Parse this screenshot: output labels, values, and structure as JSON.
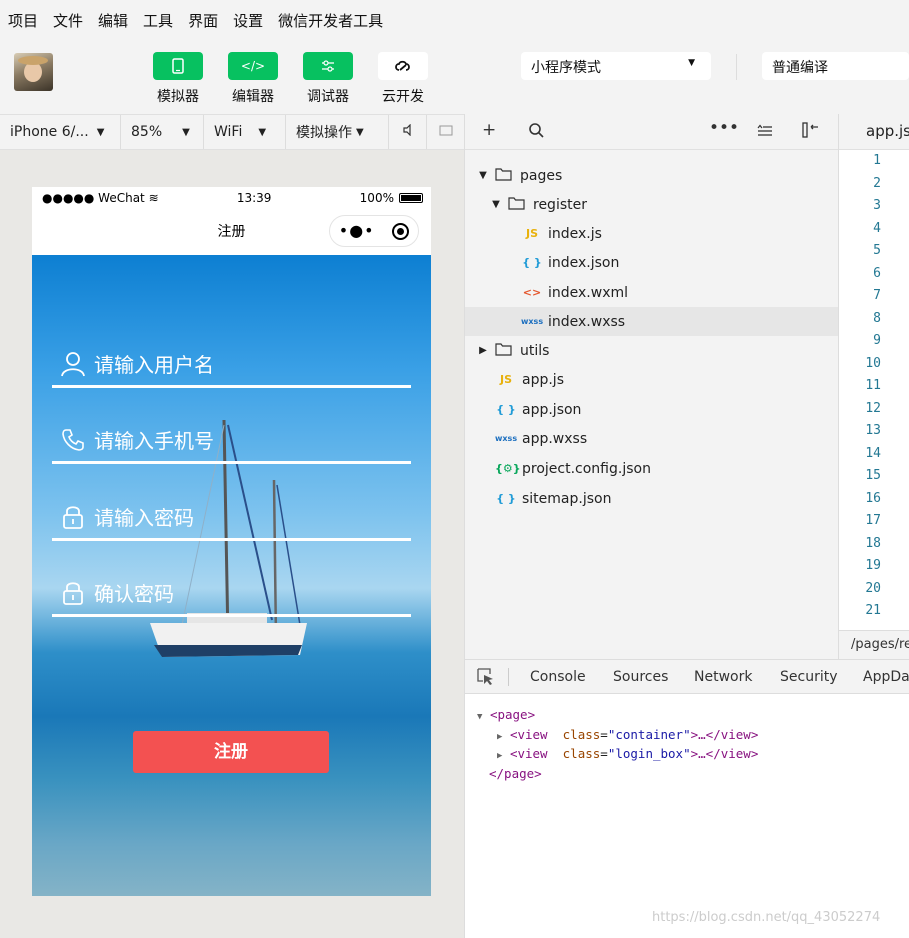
{
  "menu": [
    "项目",
    "文件",
    "编辑",
    "工具",
    "界面",
    "设置",
    "微信开发者工具"
  ],
  "toolbar": {
    "simulator": "模拟器",
    "editor": "编辑器",
    "debugger": "调试器",
    "cloud": "云开发",
    "mode_select": "小程序模式",
    "compile_select": "普通编译"
  },
  "device_bar": {
    "device": "iPhone 6/...",
    "zoom": "85%",
    "network": "WiFi",
    "simulate": "模拟操作"
  },
  "phone": {
    "carrier": "●●●●● WeChat",
    "time": "13:39",
    "battery": "100%",
    "nav_title": "注册",
    "fields": {
      "username": "请输入用户名",
      "phone": "请输入手机号",
      "password": "请输入密码",
      "confirm": "确认密码"
    },
    "register_button": "注册"
  },
  "file_tree": {
    "pages": "pages",
    "register": "register",
    "index_js": "index.js",
    "index_json": "index.json",
    "index_wxml": "index.wxml",
    "index_wxss": "index.wxss",
    "utils": "utils",
    "app_js": "app.js",
    "app_json": "app.json",
    "app_wxss": "app.wxss",
    "project_config": "project.config.json",
    "sitemap": "sitemap.json"
  },
  "editor": {
    "tab": "app.js",
    "line_numbers": [
      "1",
      "2",
      "3",
      "4",
      "5",
      "6",
      "7",
      "8",
      "9",
      "10",
      "11",
      "12",
      "13",
      "14",
      "15",
      "16",
      "17",
      "18",
      "19",
      "20",
      "21"
    ],
    "path": "/pages/re"
  },
  "devtools": {
    "tabs": [
      "Console",
      "Sources",
      "Network",
      "Security",
      "AppData"
    ],
    "dom": {
      "page_open": "<page>",
      "view1_tag": "<view",
      "view1_attr": "class",
      "view1_val": "\"container\"",
      "view2_tag": "<view",
      "view2_attr": "class",
      "view2_val": "\"login_box\"",
      "ellipsis": ">…</view>",
      "page_close": "</page>"
    }
  },
  "watermark": "https://blog.csdn.net/qq_43052274",
  "colors": {
    "accent_green": "#07c160",
    "register_red": "#f35151"
  }
}
